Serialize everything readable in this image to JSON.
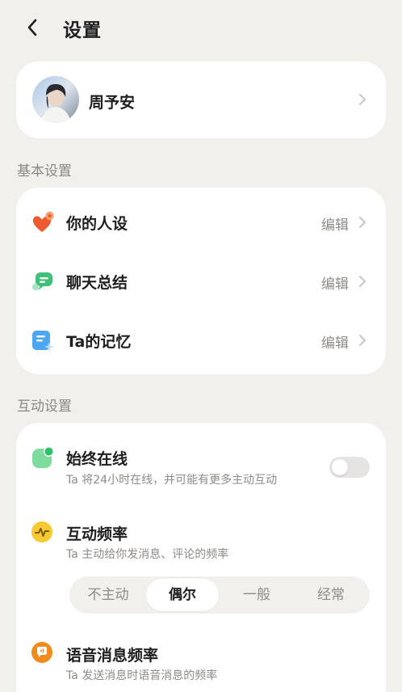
{
  "header": {
    "title": "设置"
  },
  "profile": {
    "name": "周予安"
  },
  "basic_section": {
    "label": "基本设置",
    "rows": [
      {
        "label": "你的人设",
        "action": "编辑",
        "icon": "heart-flower-icon",
        "color": "#ef5a2f"
      },
      {
        "label": "聊天总结",
        "action": "编辑",
        "icon": "chat-bubble-icon",
        "color": "#3fbf77"
      },
      {
        "label": "Ta的记忆",
        "action": "编辑",
        "icon": "memory-note-icon",
        "color": "#4da6f0"
      }
    ]
  },
  "interact_section": {
    "label": "互动设置",
    "always_online": {
      "title": "始终在线",
      "desc": "Ta 将24小时在线，并可能有更多主动互动",
      "enabled": false,
      "color": "#3fcf77"
    },
    "frequency": {
      "title": "互动频率",
      "desc": "Ta 主动给你发消息、评论的频率",
      "options": [
        "不主动",
        "偶尔",
        "一般",
        "经常"
      ],
      "selected": "偶尔",
      "color": "#f7c933"
    },
    "voice_frequency": {
      "title": "语音消息频率",
      "desc": "Ta 发送消息时语音消息的频率",
      "color": "#f28a1c"
    }
  }
}
